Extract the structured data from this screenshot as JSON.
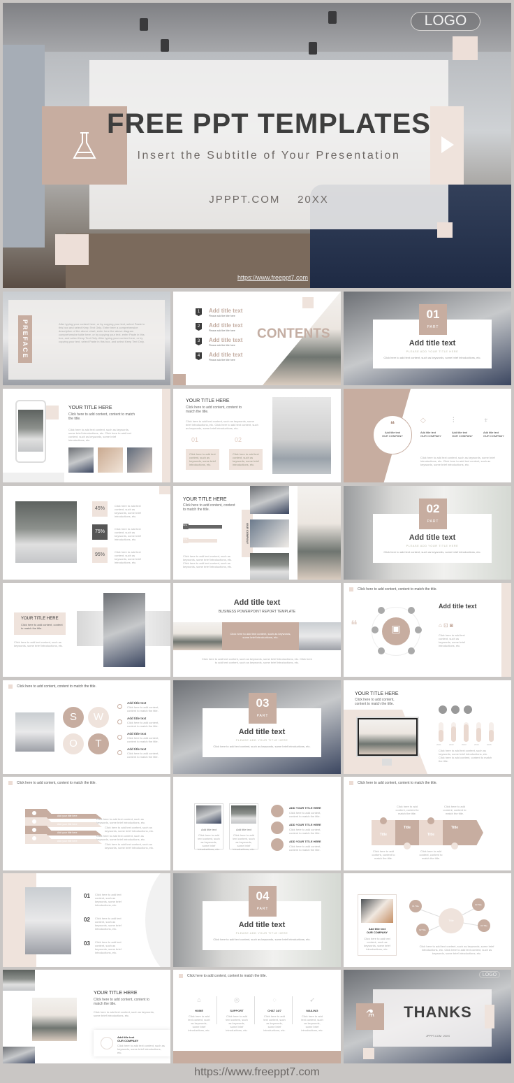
{
  "hero": {
    "logo": "LOGO",
    "title": "FREE PPT TEMPLATES",
    "subtitle": "Insert the Subtitle of Your Presentation",
    "site": "JPPPT.COM",
    "year": "20XX",
    "url": "https://www.freeppt7.com",
    "icons": {
      "left": "flask-icon",
      "right": "play-icon"
    }
  },
  "colors": {
    "brand": "#c7ada0",
    "light": "#efe3dc",
    "dark": "#444444",
    "frame": "#c9c6c4"
  },
  "slides": {
    "preface": {
      "label": "PREFACE",
      "body": "After typing your content here, or by copying your text, select Paste in this box and select Keep Text Only. Enter here a comprehensive description of the above chart; enter here the above diagram comprehensive table here, or by copying your text, enter Paste in this box, and select Keep Text Only. After typing your content here, or by copying your text, select Paste in this box, and select Keep Text Only."
    },
    "contents": {
      "heading": "CONTENTS",
      "items": [
        {
          "num": "1",
          "title": "Add title text",
          "sub": "Please add the title here"
        },
        {
          "num": "2",
          "title": "Add title text",
          "sub": "Please add the title here"
        },
        {
          "num": "3",
          "title": "Add title text",
          "sub": "Please add the title here"
        },
        {
          "num": "4",
          "title": "Add title text",
          "sub": "Please add the title here"
        }
      ]
    },
    "parts": [
      {
        "num": "01",
        "part": "PART",
        "title": "Add title text",
        "sub": "PLEASE ADD YOUR TITLE HERE",
        "desc": "Click here to add text content, such as keywords, some brief introductions, etc."
      },
      {
        "num": "02",
        "part": "PART",
        "title": "Add title text",
        "sub": "PLEASE ADD YOUR TITLE HERE",
        "desc": "Click here to add text content, such as keywords, some brief introductions, etc."
      },
      {
        "num": "03",
        "part": "PART",
        "title": "Add title text",
        "sub": "PLEASE ADD YOUR TITLE HERE",
        "desc": "Click here to add text content, such as keywords, some brief introductions, etc."
      },
      {
        "num": "04",
        "part": "PART",
        "title": "Add title text",
        "sub": "PLEASE ADD YOUR TITLE HERE",
        "desc": "Click here to add text content, such as keywords, some brief introductions, etc."
      }
    ],
    "phone": {
      "title": "YOUR TITLE HERE",
      "sub": "Click here to add content, content to match the title.",
      "body": "Click here to add text content, such as keywords, some brief introductions, etc. Click here to add text content, such as keywords, some brief introductions, etc."
    },
    "numbered": {
      "title": "YOUR TITLE HERE",
      "sub": "Click here to add content, content to match the title.",
      "body": "Click here to add text content, such as keywords, some brief introductions, etc. Click here to add text content, such as keywords, some brief introductions, etc.",
      "n1": "01",
      "n2": "02",
      "box": "Click here to add text content, such as keywords, some brief introductions, etc."
    },
    "company": {
      "quote_title": "Add title text",
      "quote_sub": "OUR COMPANY",
      "col_title": "Add title text",
      "col_sub": "OUR COMPANY",
      "body": "Click here to add text content, such as keywords, some brief introductions, etc. Click here to add text content, such as keywords, some brief introductions, etc."
    },
    "percents": {
      "values": [
        "45%",
        "75%",
        "95%"
      ],
      "desc": "Click here to add text content, such as keywords, some brief introductions, etc."
    },
    "progress": {
      "title": "YOUR TITLE HERE",
      "sub": "Click here to add content, content to match the title.",
      "bar1": "80%",
      "bar2": "70%",
      "bar1_value": 0.8,
      "bar2_value": 0.7,
      "label": "OUR COMPANY",
      "body": "Click here to add text content, such as keywords, some brief introductions, etc. Click here to add text content, such as keywords, some brief introductions, etc."
    },
    "collage": {
      "title": "YOUR TITLE HERE",
      "sub": "Click here to add content, content to match the title.",
      "body": "Click here to add text content, such as keywords, some brief introductions, etc."
    },
    "report": {
      "title": "Add title text",
      "sub": "BUSINESS POWERPOINT REPORT TEMPLATE",
      "band": "Click here to add text content, such as keywords, some brief introductions, etc.",
      "body": "Click here to add text content, such as keywords, some brief introductions, etc. Click here to add text content, such as keywords, some brief introductions, etc."
    },
    "social": {
      "header": "Click here to add content, content to match the title.",
      "title": "Add title text",
      "body": "Click here to add text content, such as keywords, some brief introductions, etc."
    },
    "swot": {
      "header": "Click here to add content, content to match the title.",
      "letters": [
        "S",
        "W",
        "O",
        "T"
      ],
      "item_title": "Add title text",
      "item_desc": "Click here to add content, content to match the title."
    },
    "monitor": {
      "title": "YOUR TITLE HERE",
      "sub": "Click here to add content, content to match the title.",
      "years": [
        "2021",
        "2022",
        "2023",
        "2024",
        "2025"
      ],
      "levels": [
        0.6,
        0.8,
        0.9,
        0.7,
        0.6
      ],
      "body": "Click here to add text content, such as keywords, some brief introductions, etc. Click here to add content, content to match the title."
    },
    "arrows": {
      "header": "Click here to add content, content to match the title.",
      "label": "Add your title here",
      "desc": "Click here to add text content, such as keywords, some brief introductions, etc."
    },
    "cards": {
      "card_title": "Add title text",
      "card_desc": "Click here to add text content, such as keywords, some brief introductions, etc.",
      "item_title": "ADD YOUR TITLE HERE",
      "item_desc": "Click here to add content, content to match the title."
    },
    "puzzle": {
      "header": "Click here to add content, content to match the title.",
      "piece": "Title",
      "desc": "Click here to add content, content to match the title."
    },
    "list3": {
      "nums": [
        "01",
        "02",
        "03"
      ],
      "desc": "Click here to add text content, such as keywords, some brief introductions, etc."
    },
    "network": {
      "card_title": "Add title text",
      "card_sub": "OUR COMPANY",
      "card_desc": "Click here to add text content, such as keywords, some brief introductions, etc.",
      "center": "Title",
      "nodes": [
        "01 Title",
        "02 Title",
        "03 Title",
        "04 Title"
      ],
      "body": "Click here to add text content, such as keywords, some brief introductions, etc. Click here to add text content, such as keywords, some brief introductions, etc."
    },
    "yoga": {
      "title": "YOUR TITLE HERE",
      "sub": "Click here to add content, content to match the title.",
      "body": "Click here to add text content, such as keywords, some brief introductions, etc.",
      "card_title": "Add title text",
      "card_sub": "OUR COMPANY",
      "card_desc": "Click here to add text content, such as keywords, some brief introductions, etc."
    },
    "services": {
      "header": "Click here to add content, content to match the title.",
      "items": [
        {
          "label": "HOME",
          "icon": "home-icon"
        },
        {
          "label": "SUPPORT",
          "icon": "support-icon"
        },
        {
          "label": "CHAT 24/7",
          "icon": "chat-icon"
        },
        {
          "label": "MAILING",
          "icon": "paper-plane-icon"
        }
      ],
      "desc": "Click here to add text content, such as keywords, some brief introductions, etc."
    },
    "thanks": {
      "logo": "LOGO",
      "title": "THANKS",
      "site": "JPPPT.COM",
      "year": "20XX"
    }
  },
  "footer": {
    "url": "https://www.freeppt7.com"
  }
}
